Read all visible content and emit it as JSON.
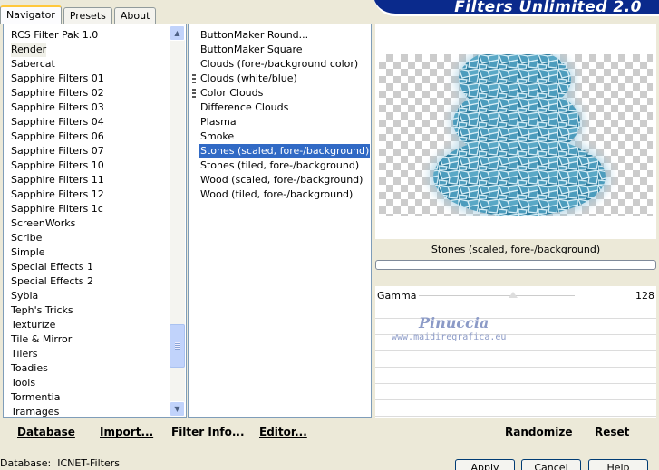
{
  "tabs": [
    "Navigator",
    "Presets",
    "About"
  ],
  "banner": {
    "title": "Filters Unlimited 2.0"
  },
  "categories": [
    "RCS Filter Pak 1.0",
    "Render",
    "Sabercat",
    "Sapphire Filters 01",
    "Sapphire Filters 02",
    "Sapphire Filters 03",
    "Sapphire Filters 04",
    "Sapphire Filters 06",
    "Sapphire Filters 07",
    "Sapphire Filters 10",
    "Sapphire Filters 11",
    "Sapphire Filters 12",
    "Sapphire Filters 1c",
    "ScreenWorks",
    "Scribe",
    "Simple",
    "Special Effects 1",
    "Special Effects 2",
    "Sybia",
    "Teph's Tricks",
    "Texturize",
    "Tile & Mirror",
    "Tilers",
    "Toadies",
    "Tools",
    "Tormentia",
    "Tramages"
  ],
  "filters": [
    "ButtonMaker Round...",
    "ButtonMaker Square",
    "Clouds (fore-/background color)",
    "Clouds (white/blue)",
    "Color Clouds",
    "Difference Clouds",
    "Plasma",
    "Smoke",
    "Stones (scaled, fore-/background)",
    "Stones (tiled, fore-/background)",
    "Wood (scaled, fore-/background)",
    "Wood (tiled, fore-/background)"
  ],
  "preview": {
    "filter_name": "Stones (scaled, fore-/background)"
  },
  "params": {
    "label": "Gamma",
    "value": "128"
  },
  "watermark": {
    "name": "Pinuccia",
    "url": "www.maidiregrafica.eu"
  },
  "toolbar": {
    "database": "Database",
    "import": "Import...",
    "filter_info": "Filter Info...",
    "editor": "Editor...",
    "randomize": "Randomize",
    "reset": "Reset"
  },
  "status": {
    "label": "Database:",
    "value": "ICNET-Filters"
  },
  "buttons": {
    "apply": "Apply",
    "cancel": "Cancel",
    "help": "Help"
  },
  "colors": {
    "selection": "#316ac5",
    "banner": "#0a2a8c"
  }
}
